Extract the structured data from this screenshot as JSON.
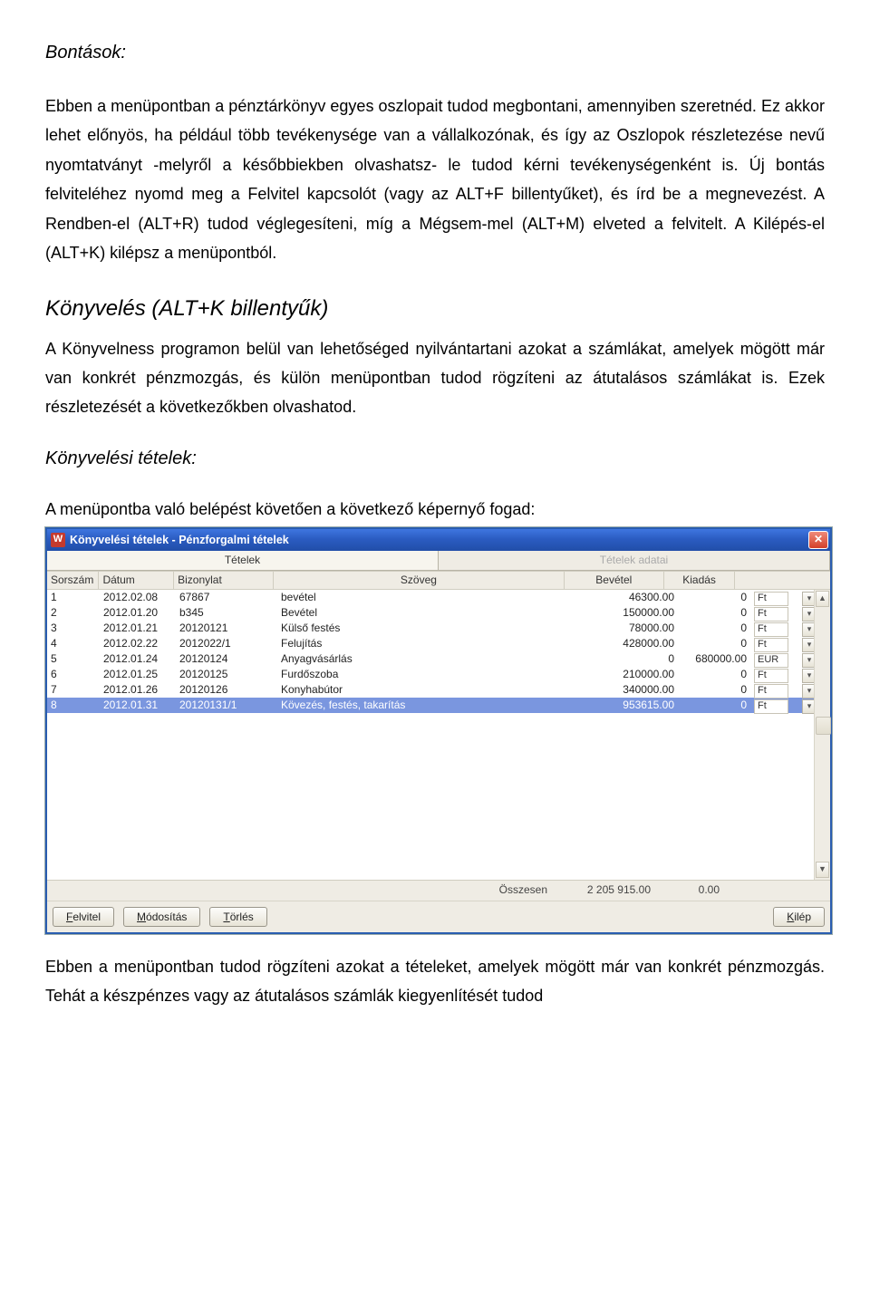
{
  "text": {
    "h_bontasok": "Bontások:",
    "p1": "Ebben a menüpontban a pénztárkönyv egyes oszlopait tudod megbontani, amennyiben szeretnéd. Ez akkor lehet előnyös, ha például több tevékenysége van a vállalkozónak, és így az Oszlopok részletezése nevű nyomtatványt -melyről a későbbiekben olvashatsz- le tudod kérni tevékenységenként is. Új bontás felviteléhez nyomd meg a Felvitel kapcsolót (vagy az ALT+F billentyűket), és írd be a megnevezést. A Rendben-el (ALT+R) tudod véglegesíteni, míg a Mégsem-mel (ALT+M) elveted a felvitelt. A Kilépés-el (ALT+K) kilépsz a menüpontból.",
    "h_konyveles": "Könyvelés (ALT+K billentyűk)",
    "p2": "A Könyvelness programon belül van lehetőséged nyilvántartani azokat a számlákat, amelyek mögött már van konkrét pénzmozgás, és külön menüpontban tudod rögzíteni az átutalásos számlákat is. Ezek részletezését a következőkben olvashatod.",
    "h_tetelek": "Könyvelési tételek:",
    "caption": "A menüpontba való belépést követően a következő képernyő fogad:",
    "p3": "Ebben a menüpontban tudod rögzíteni azokat a tételeket, amelyek mögött már van konkrét pénzmozgás. Tehát a készpénzes vagy az átutalásos számlák kiegyenlítését tudod"
  },
  "window": {
    "title": "Könyvelési tételek - Pénzforgalmi tételek",
    "app_icon_letter": "W",
    "tabs": {
      "active": "Tételek",
      "inactive": "Tételek adatai"
    },
    "columns": {
      "sorszam": "Sorszám",
      "datum": "Dátum",
      "bizonylat": "Bizonylat",
      "szoveg": "Szöveg",
      "bevetel": "Bevétel",
      "kiadas": "Kiadás"
    },
    "rows": [
      {
        "n": "1",
        "d": "2012.02.08",
        "b": "67867",
        "s": "bevétel",
        "bev": "46300.00",
        "kiad": "0",
        "cur": "Ft"
      },
      {
        "n": "2",
        "d": "2012.01.20",
        "b": "b345",
        "s": "Bevétel",
        "bev": "150000.00",
        "kiad": "0",
        "cur": "Ft"
      },
      {
        "n": "3",
        "d": "2012.01.21",
        "b": "20120121",
        "s": "Külső festés",
        "bev": "78000.00",
        "kiad": "0",
        "cur": "Ft"
      },
      {
        "n": "4",
        "d": "2012.02.22",
        "b": "2012022/1",
        "s": "Felujítás",
        "bev": "428000.00",
        "kiad": "0",
        "cur": "Ft"
      },
      {
        "n": "5",
        "d": "2012.01.24",
        "b": "20120124",
        "s": "Anyagvásárlás",
        "bev": "0",
        "kiad": "680000.00",
        "cur": "EUR"
      },
      {
        "n": "6",
        "d": "2012.01.25",
        "b": "20120125",
        "s": "Furdőszoba",
        "bev": "210000.00",
        "kiad": "0",
        "cur": "Ft"
      },
      {
        "n": "7",
        "d": "2012.01.26",
        "b": "20120126",
        "s": "Konyhabútor",
        "bev": "340000.00",
        "kiad": "0",
        "cur": "Ft"
      },
      {
        "n": "8",
        "d": "2012.01.31",
        "b": "20120131/1",
        "s": "Kövezés, festés, takarítás",
        "bev": "953615.00",
        "kiad": "0",
        "cur": "Ft",
        "selected": true
      }
    ],
    "summary": {
      "label": "Összesen",
      "bev": "2 205 915.00",
      "kiad": "0.00"
    },
    "buttons": {
      "felvitel": "Felvitel",
      "felvitel_u": "F",
      "modositas": "Módosítás",
      "modositas_u": "M",
      "torles": "Törlés",
      "torles_u": "T",
      "kilep": "Kilép",
      "kilep_u": "K"
    }
  }
}
